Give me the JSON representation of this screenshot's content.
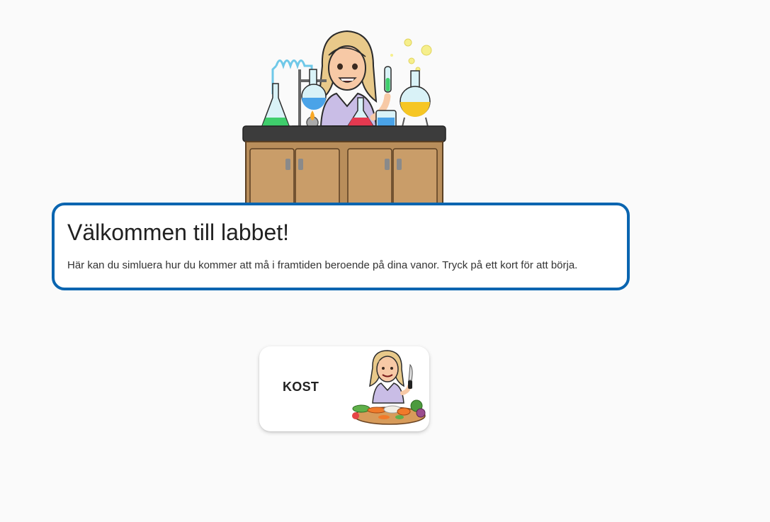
{
  "welcome": {
    "title": "Välkommen till labbet!",
    "text": "Här kan du simluera hur du kommer att må i framtiden beroende på dina vanor. Tryck på ett kort för att börja."
  },
  "cards": [
    {
      "label": "KOST",
      "icon": "chef-avatar-with-vegetables"
    }
  ],
  "hero": {
    "icon": "scientist-avatar-lab-bench"
  },
  "colors": {
    "accent": "#0a65b0",
    "background": "#fafafa",
    "card": "#ffffff"
  }
}
